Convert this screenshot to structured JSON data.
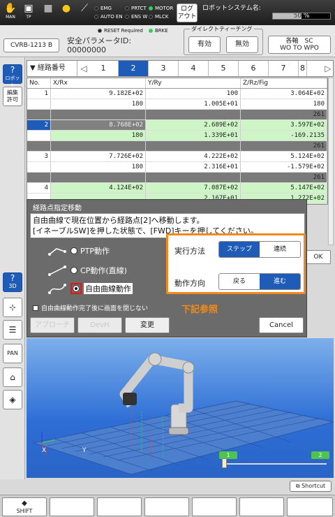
{
  "topbar": {
    "icons": [
      {
        "name": "man-hand-icon",
        "label": "MAN"
      },
      {
        "name": "tp-icon",
        "label": "TP"
      },
      {
        "name": "stop-square-icon",
        "label": ""
      },
      {
        "name": "lightbulb-icon",
        "label": ""
      },
      {
        "name": "wrench-icon",
        "label": ""
      }
    ],
    "status": {
      "emg": "EMG",
      "prtct": "PRTCT",
      "motor": "MOTOR",
      "auto_en": "AUTO EN",
      "ens_w": "ENS W",
      "mlck": "MLCK"
    },
    "logout_label": "ログ\nアウト",
    "system_name_label": "ロボットシステム名:",
    "speed_percent_label": "50 %",
    "speed_percent": 50
  },
  "bar2": {
    "robot_button": "CVRB-1213 B",
    "reset_required": "RESET Required",
    "brke": "BRKE",
    "safety_label": "安全パラメータID:",
    "safety_id": "00000000",
    "direct_teach_title": "ダイレクトティーチング",
    "enable": "有効",
    "disable": "無効",
    "axes_line1": "各軸　SC",
    "axes_line2": "WO TO WPO"
  },
  "left": {
    "robot": "ロボット",
    "edit": "編集\n許可",
    "view3d": "3D",
    "pan": "PAN"
  },
  "tabs": {
    "header": "▼ 経路番号",
    "left_arrow": "◁",
    "right_arrow": "▷",
    "items": [
      "1",
      "2",
      "3",
      "4",
      "5",
      "6",
      "7",
      "8"
    ],
    "active": "2"
  },
  "table": {
    "columns": [
      "No.",
      "X/Rx",
      "Y/Ry",
      "Z/Rz/Fig"
    ],
    "rows": [
      {
        "no": "1",
        "x": "9.182E+02",
        "y": "100",
        "z": "3.064E+02",
        "style": ""
      },
      {
        "no": "",
        "x": "180",
        "y": "1.005E+01",
        "z": "180",
        "style": ""
      },
      {
        "no": "",
        "x": "",
        "y": "",
        "z": "261",
        "style": "sep"
      },
      {
        "no": "2",
        "x": "8.768E+02",
        "y": "2.689E+02",
        "z": "3.597E+02",
        "style": "green sel"
      },
      {
        "no": "",
        "x": "180",
        "y": "1.339E+01",
        "z": "-169.2135",
        "style": "green"
      },
      {
        "no": "",
        "x": "",
        "y": "",
        "z": "261",
        "style": "sep"
      },
      {
        "no": "3",
        "x": "7.726E+02",
        "y": "4.222E+02",
        "z": "5.124E+02",
        "style": ""
      },
      {
        "no": "",
        "x": "180",
        "y": "2.316E+01",
        "z": "-1.579E+02",
        "style": ""
      },
      {
        "no": "",
        "x": "",
        "y": "",
        "z": "261",
        "style": "sep"
      },
      {
        "no": "4",
        "x": "4.124E+02",
        "y": "7.087E+02",
        "z": "5.147E+02",
        "style": "green"
      },
      {
        "no": "",
        "x": "",
        "y": "2.167E+01",
        "z": "1.272E+02",
        "style": "green"
      }
    ]
  },
  "dialog": {
    "title": "経路点指定移動",
    "message_line1": "自由曲線で現在位置から経路点[2]へ移動します。",
    "message_line2": "[イネーブルSW]を押した状態で、[FWD]キーを押してください。",
    "ptp": "PTP動作",
    "cp": "CP動作(直線)",
    "free": "自由曲線動作",
    "close_check": "自由曲線動作完了後に画面を閉じない",
    "approach": "アプローチ",
    "depart": "DevH",
    "change": "変更",
    "cancel": "Cancel"
  },
  "callout": {
    "exec_label": "実行方法",
    "step": "ステップ",
    "continuous": "連続",
    "direction_label": "動作方向",
    "back": "戻る",
    "forward": "進む",
    "note": "下記参照"
  },
  "ok_label": "OK",
  "view": {
    "tag1": "1",
    "tag2": "2",
    "axis_x": "X",
    "axis_y": "Y"
  },
  "bottom": {
    "shortcut": "Shortcut",
    "shift": "SHIFT"
  },
  "colors": {
    "accent": "#1f5cb8",
    "green_row": "#cdf5c5",
    "callout": "#f08a1c",
    "highlight": "#e11111"
  }
}
